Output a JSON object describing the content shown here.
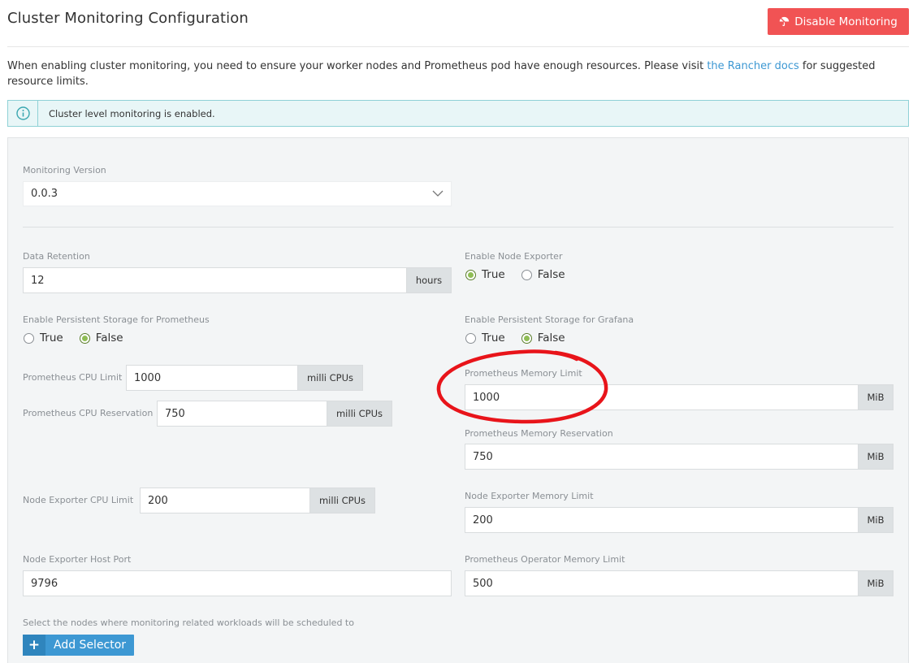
{
  "header": {
    "title": "Cluster Monitoring Configuration",
    "disable_button": "Disable Monitoring",
    "disable_icon": "umbrella-off-icon",
    "accent_color": "#f15354"
  },
  "intro": {
    "text_before": "When enabling cluster monitoring, you need to ensure your worker nodes and Prometheus pod have enough resources. Please visit ",
    "link_text": "the Rancher docs",
    "text_after": " for suggested resource limits."
  },
  "banner": {
    "icon": "info-icon",
    "text": "Cluster level monitoring is enabled."
  },
  "version": {
    "label": "Monitoring Version",
    "value": "0.0.3"
  },
  "data_retention": {
    "label": "Data Retention",
    "value": "12",
    "unit": "hours"
  },
  "node_exporter_enable": {
    "label": "Enable Node Exporter",
    "options": [
      "True",
      "False"
    ],
    "selected": "True"
  },
  "persistent_prometheus": {
    "label": "Enable Persistent Storage for Prometheus",
    "options": [
      "True",
      "False"
    ],
    "selected": "False"
  },
  "persistent_grafana": {
    "label": "Enable Persistent Storage for Grafana",
    "options": [
      "True",
      "False"
    ],
    "selected": "False"
  },
  "prometheus_cpu_limit": {
    "label": "Prometheus CPU Limit",
    "value": "1000",
    "unit": "milli CPUs"
  },
  "prometheus_cpu_reservation": {
    "label": "Prometheus CPU Reservation",
    "value": "750",
    "unit": "milli CPUs"
  },
  "prometheus_memory_limit": {
    "label": "Prometheus Memory Limit",
    "value": "1000",
    "unit": "MiB"
  },
  "prometheus_memory_reservation": {
    "label": "Prometheus Memory Reservation",
    "value": "750",
    "unit": "MiB"
  },
  "node_exporter_cpu_limit": {
    "label": "Node Exporter CPU Limit",
    "value": "200",
    "unit": "milli CPUs"
  },
  "node_exporter_memory_limit": {
    "label": "Node Exporter Memory Limit",
    "value": "200",
    "unit": "MiB"
  },
  "node_exporter_host_port": {
    "label": "Node Exporter Host Port",
    "value": "9796"
  },
  "operator_memory_limit": {
    "label": "Prometheus Operator Memory Limit",
    "value": "500",
    "unit": "MiB"
  },
  "selector": {
    "label": "Select the nodes where monitoring related workloads will be scheduled to",
    "button": "Add Selector",
    "button_color": "#3d98d3"
  },
  "annotation_color": "#e8141a"
}
